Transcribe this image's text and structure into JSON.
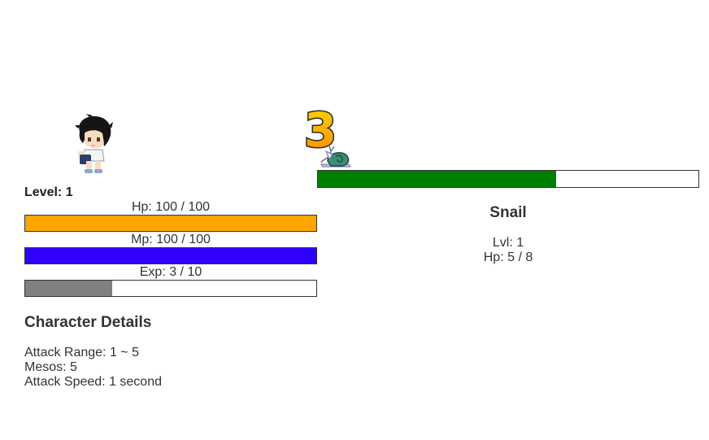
{
  "player": {
    "level_text": "Level: 1",
    "hp": {
      "label": "Hp: 100 / 100",
      "current": 100,
      "max": 100,
      "color": "#ffa500"
    },
    "mp": {
      "label": "Mp: 100 / 100",
      "current": 100,
      "max": 100,
      "color": "#2f00ff"
    },
    "exp": {
      "label": "Exp: 3 / 10",
      "current": 3,
      "max": 10,
      "color": "#808080"
    },
    "sprite_icon": "character-sprite"
  },
  "details": {
    "title": "Character Details",
    "attack_range": "Attack Range: 1 ~ 5",
    "mesos": "Mesos: 5",
    "attack_speed": "Attack Speed: 1 second"
  },
  "monster": {
    "name": "Snail",
    "level_text": "Lvl: 1",
    "hp_text": "Hp: 5 / 8",
    "hp_current": 5,
    "hp_max": 8,
    "hp_color": "#008000",
    "sprite_icon": "snail-sprite",
    "damage_number": "3"
  }
}
